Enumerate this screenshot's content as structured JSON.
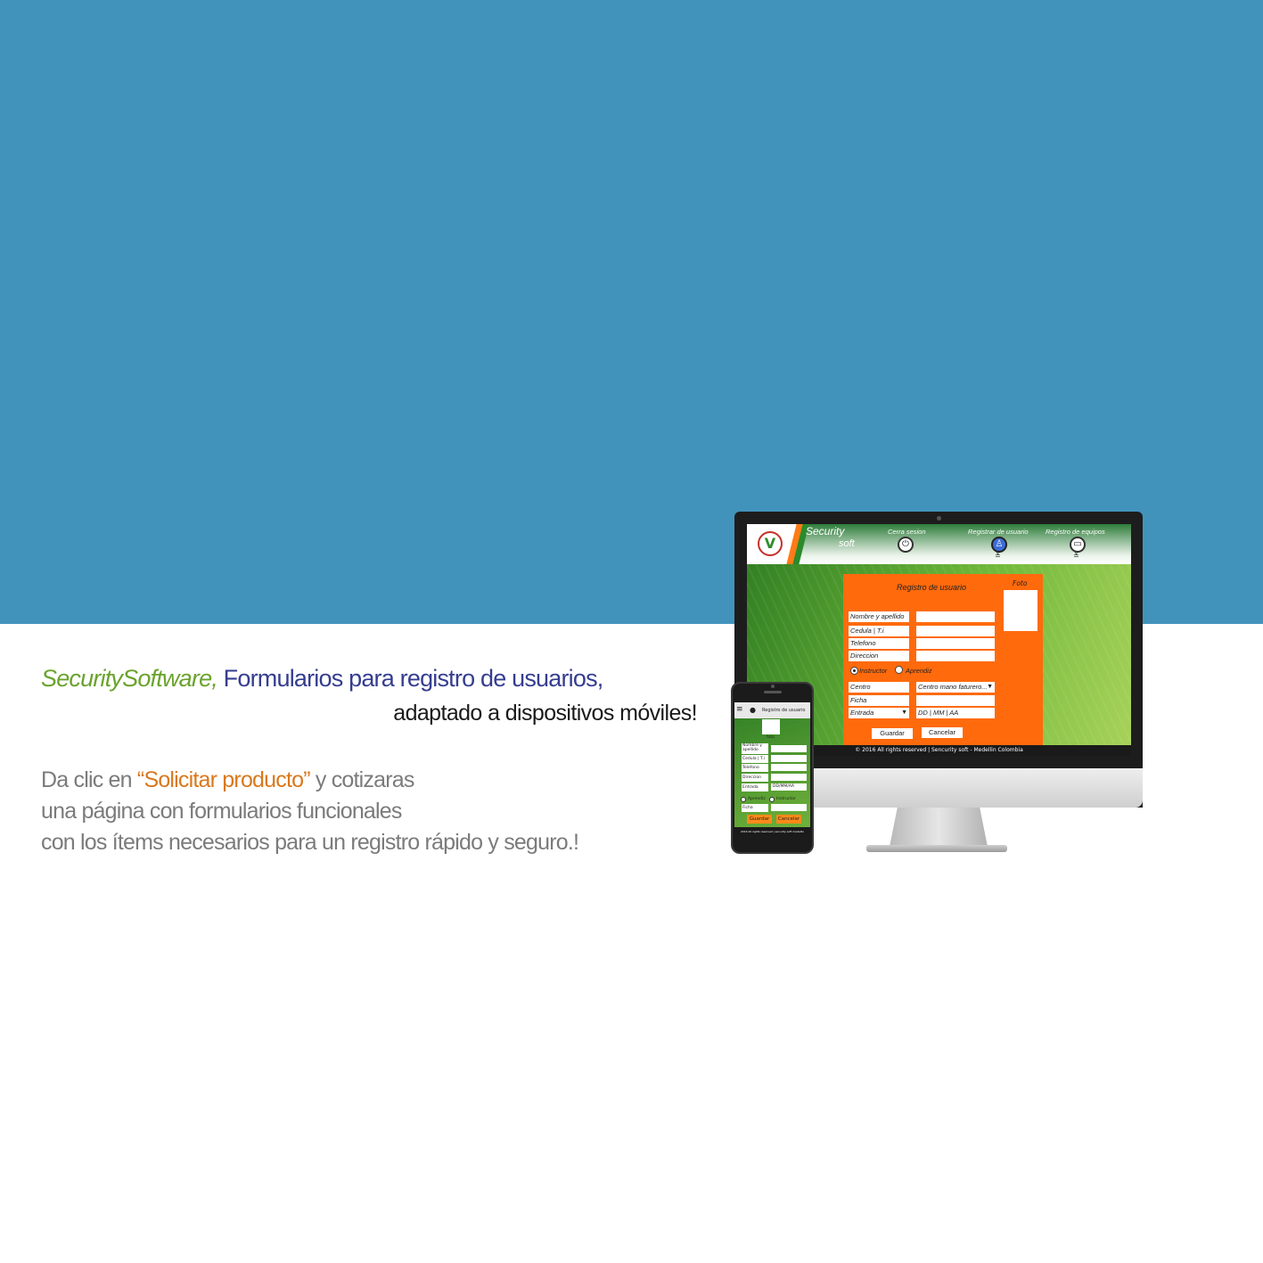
{
  "promo": {
    "headline_brand": "SecuritySoftware,",
    "headline_rest": " Formularios para registro de usuarios,",
    "subline": "adaptado a dispositivos móviles!",
    "body_line1_prefix": "Da clic en ",
    "body_line1_cta": "“Solicitar producto”",
    "body_line1_suffix": " y cotizaras",
    "body_line2": "una página con formularios funcionales",
    "body_line3": "con los ítems necesarios para un registro rápido y seguro.!"
  },
  "desktop_app": {
    "logo_letter": "V",
    "title_line1": "Security",
    "title_line2": "soft",
    "nav": [
      {
        "label": "Cerra sesion",
        "icon": "power-icon",
        "glyph": "⏻"
      },
      {
        "label": "Registrar de usuario",
        "icon": "user-icon",
        "glyph": "♙"
      },
      {
        "label": "Registro de equipos",
        "icon": "laptop-icon",
        "glyph": "▭"
      }
    ],
    "form": {
      "title": "Registro de usuario",
      "photo_label": "Foto",
      "fields": [
        "Nombre y apellido",
        "Cedula | T.i",
        "Telefono",
        "Direccion"
      ],
      "radio_instructor": "Instructor",
      "radio_aprendiz": "Aprendiz",
      "centro_label": "Centro",
      "ficha_label": "Ficha",
      "entrada_label": "Entrada",
      "centro_value": "Centro mano faturero...",
      "date_placeholder": "DD | MM | AA",
      "save_button": "Guardar",
      "cancel_button": "Cancelar"
    },
    "footer": "© 2016 All rights reserved | Sencurity soft - Medellin Colombia"
  },
  "mobile_app": {
    "title": "Registro de usuario",
    "photo_label": "foto",
    "fields": [
      "Nombre y apellido",
      "Cedula | T.i",
      "Telefono",
      "Direccion",
      "Entrada"
    ],
    "date_value": "DD/MM/AA",
    "radio_aprendiz": "Aprendiz",
    "radio_instructor": "Instructor",
    "ficha_label": "Ficha",
    "save_button": "Guardar",
    "cancel_button": "Cancelar",
    "footer": "2016 All rights reserved | security soft medellin"
  },
  "colors": {
    "top_band": "#4293bc",
    "brand_green": "#6aa32c",
    "headline_blue": "#353d8f",
    "cta_orange": "#d9781d",
    "form_orange": "#ff6a0c"
  }
}
